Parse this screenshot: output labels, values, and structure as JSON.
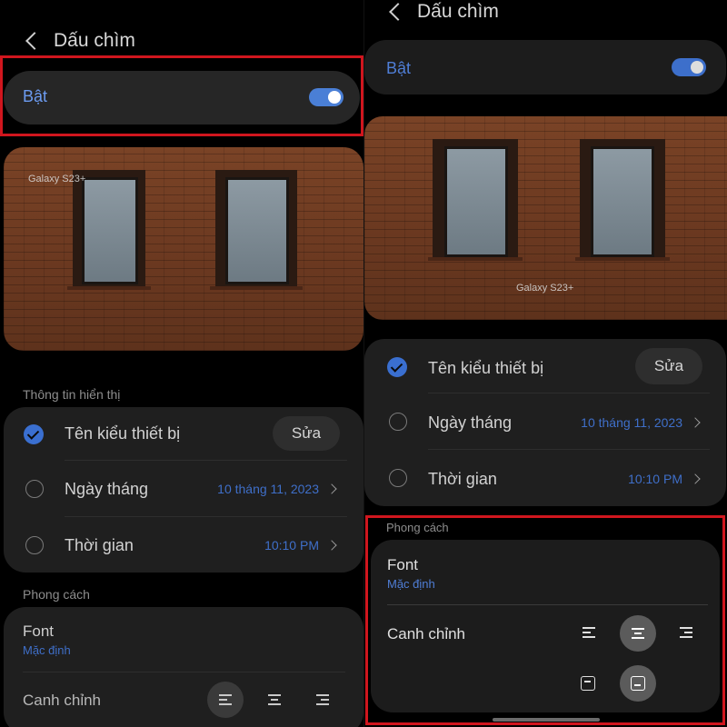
{
  "left": {
    "header": {
      "title": "Dấu chìm"
    },
    "toggle_row": {
      "label": "Bật",
      "state": "on"
    },
    "preview": {
      "watermark": "Galaxy S23+"
    },
    "display_info": {
      "section_label": "Thông tin hiển thị",
      "items": [
        {
          "label": "Tên kiểu thiết bị",
          "selected": true,
          "action": "Sửa"
        },
        {
          "label": "Ngày tháng",
          "selected": false,
          "value": "10 tháng 11, 2023"
        },
        {
          "label": "Thời gian",
          "selected": false,
          "value": "10:10 PM"
        }
      ]
    },
    "style": {
      "section_label": "Phong cách",
      "font_label": "Font",
      "font_value": "Mặc định",
      "align_label": "Canh chỉnh",
      "align_selected": "left"
    }
  },
  "right": {
    "header": {
      "title": "Dấu chìm"
    },
    "toggle_row": {
      "label": "Bật",
      "state": "on"
    },
    "preview": {
      "watermark": "Galaxy S23+"
    },
    "display_info": {
      "items": [
        {
          "label": "Tên kiểu thiết bị",
          "selected": true,
          "action": "Sửa"
        },
        {
          "label": "Ngày tháng",
          "selected": false,
          "value": "10 tháng 11, 2023"
        },
        {
          "label": "Thời gian",
          "selected": false,
          "value": "10:10 PM"
        }
      ]
    },
    "style": {
      "section_label": "Phong cách",
      "font_label": "Font",
      "font_value": "Mặc định",
      "align_label": "Canh chỉnh",
      "align_selected": "center",
      "position_selected": "bottom"
    }
  },
  "colors": {
    "accent": "#4a7fd6",
    "highlight_box": "#d0161e",
    "card": "#1f1f1f",
    "background": "#000000"
  },
  "icons": [
    "back-icon",
    "check-icon",
    "chevron-right-icon",
    "align-left-icon",
    "align-center-icon",
    "align-right-icon",
    "position-top-icon",
    "position-bottom-icon"
  ]
}
